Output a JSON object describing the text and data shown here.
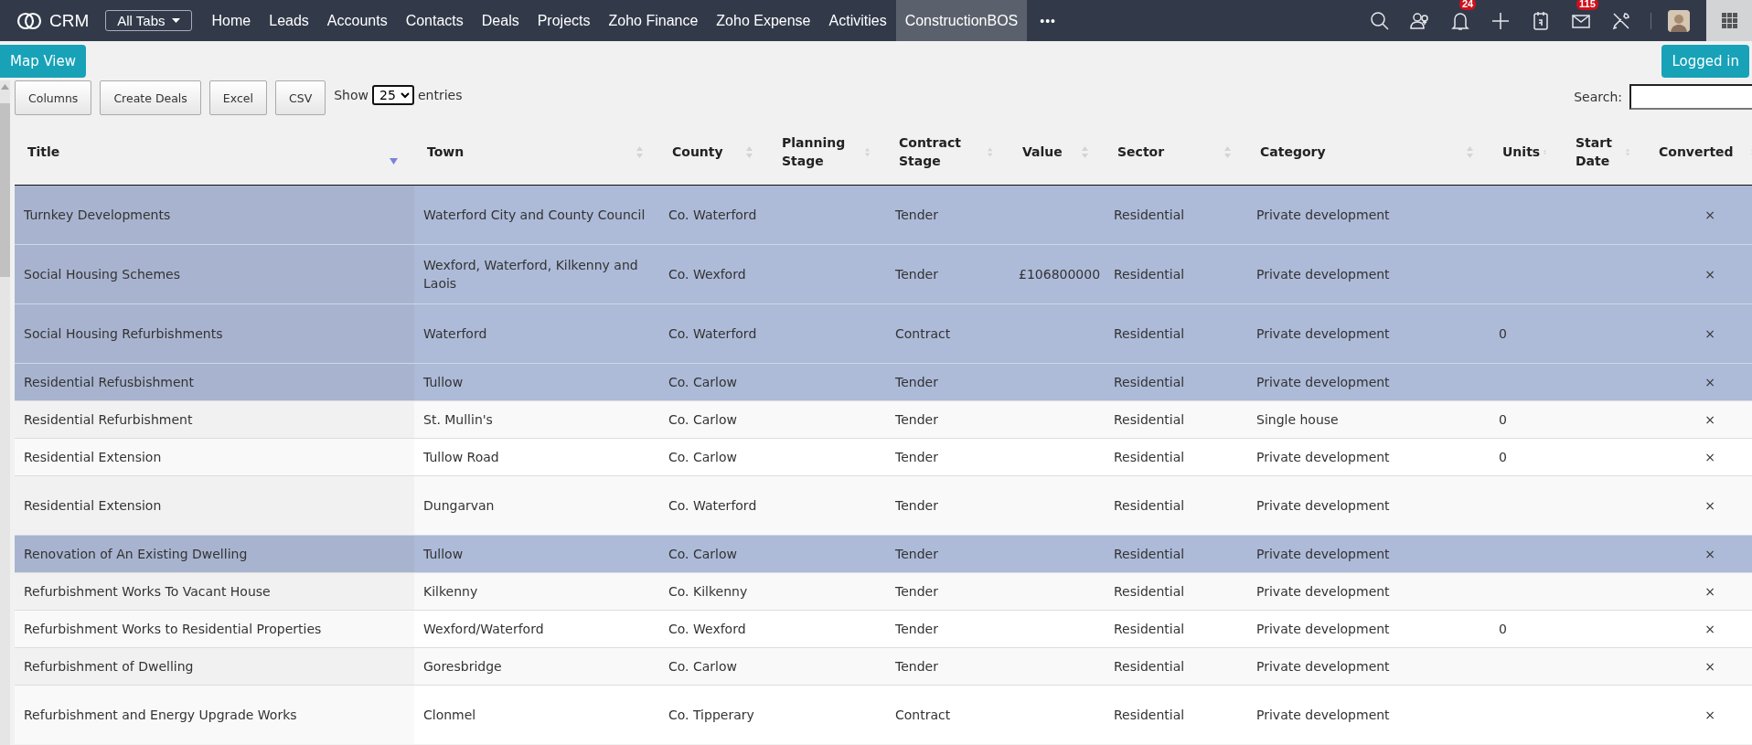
{
  "nav": {
    "logo": "CRM",
    "all_tabs": "All Tabs",
    "more": "•••",
    "tabs": [
      {
        "label": "Home",
        "selected": false
      },
      {
        "label": "Leads",
        "selected": false
      },
      {
        "label": "Accounts",
        "selected": false
      },
      {
        "label": "Contacts",
        "selected": false
      },
      {
        "label": "Deals",
        "selected": false
      },
      {
        "label": "Projects",
        "selected": false
      },
      {
        "label": "Zoho Finance",
        "selected": false
      },
      {
        "label": "Zoho Expense",
        "selected": false
      },
      {
        "label": "Activities",
        "selected": false
      },
      {
        "label": "ConstructionBOS",
        "selected": true
      }
    ],
    "notifications_badge": "24",
    "mail_badge": "115"
  },
  "map_view_button": "Map View",
  "logged_in_button": "Logged in",
  "toolbar": {
    "buttons": [
      "Columns",
      "Create Deals",
      "Excel",
      "CSV"
    ],
    "show_label": "Show",
    "page_size": "25",
    "entries_label": "entries",
    "search_label": "Search:"
  },
  "table": {
    "columns": [
      {
        "label": "Title",
        "sorted": true
      },
      {
        "label": "Town",
        "sorted": false
      },
      {
        "label": "County",
        "sorted": false
      },
      {
        "label": "Planning Stage",
        "sorted": false
      },
      {
        "label": "Contract Stage",
        "sorted": false
      },
      {
        "label": "Value",
        "sorted": false
      },
      {
        "label": "Sector",
        "sorted": false
      },
      {
        "label": "Category",
        "sorted": false
      },
      {
        "label": "Units",
        "sorted": false
      },
      {
        "label": "Start Date",
        "sorted": false
      },
      {
        "label": "Converted",
        "sorted": false
      }
    ],
    "rows": [
      {
        "selected": true,
        "title": "Turnkey Developments",
        "town": "Waterford City and County Council",
        "county": "Co. Waterford",
        "contract_stage": "Tender",
        "sector": "Residential",
        "category": "Private development",
        "converted": "×"
      },
      {
        "selected": true,
        "title": "Social Housing Schemes",
        "town": "Wexford, Waterford, Kilkenny and Laois",
        "county": "Co. Wexford",
        "contract_stage": "Tender",
        "value": "£106800000",
        "sector": "Residential",
        "category": "Private development",
        "converted": "×"
      },
      {
        "selected": true,
        "title": "Social Housing Refurbishments",
        "town": "Waterford",
        "county": "Co. Waterford",
        "contract_stage": "Contract",
        "sector": "Residential",
        "category": "Private development",
        "units": "0",
        "converted": "×"
      },
      {
        "selected": true,
        "title": "Residential Refusbishment",
        "town": "Tullow",
        "county": "Co. Carlow",
        "contract_stage": "Tender",
        "sector": "Residential",
        "category": "Private development",
        "converted": "×"
      },
      {
        "selected": false,
        "title": "Residential Refurbishment",
        "town": "St. Mullin's",
        "county": "Co. Carlow",
        "contract_stage": "Tender",
        "sector": "Residential",
        "category": "Single house",
        "units": "0",
        "converted": "×"
      },
      {
        "selected": false,
        "title": "Residential Extension",
        "town": "Tullow Road",
        "county": "Co. Carlow",
        "contract_stage": "Tender",
        "sector": "Residential",
        "category": "Private development",
        "units": "0",
        "converted": "×"
      },
      {
        "selected": false,
        "title": "Residential Extension",
        "town": "Dungarvan",
        "county": "Co. Waterford",
        "contract_stage": "Tender",
        "sector": "Residential",
        "category": "Private development",
        "converted": "×"
      },
      {
        "selected": true,
        "title": "Renovation of An Existing Dwelling",
        "town": "Tullow",
        "county": "Co. Carlow",
        "contract_stage": "Tender",
        "sector": "Residential",
        "category": "Private development",
        "converted": "×"
      },
      {
        "selected": false,
        "title": "Refurbishment Works To Vacant House",
        "town": "Kilkenny",
        "county": "Co. Kilkenny",
        "contract_stage": "Tender",
        "sector": "Residential",
        "category": "Private development",
        "converted": "×"
      },
      {
        "selected": false,
        "title": "Refurbishment Works to Residential Properties",
        "town": "Wexford/Waterford",
        "county": "Co. Wexford",
        "contract_stage": "Tender",
        "sector": "Residential",
        "category": "Private development",
        "units": "0",
        "converted": "×"
      },
      {
        "selected": false,
        "title": "Refurbishment of Dwelling",
        "town": "Goresbridge",
        "county": "Co. Carlow",
        "contract_stage": "Tender",
        "sector": "Residential",
        "category": "Private development",
        "converted": "×"
      },
      {
        "selected": false,
        "title": "Refurbishment and Energy Upgrade Works",
        "town": "Clonmel",
        "county": "Co. Tipperary",
        "contract_stage": "Contract",
        "sector": "Residential",
        "category": "Private development",
        "converted": "×"
      }
    ]
  }
}
